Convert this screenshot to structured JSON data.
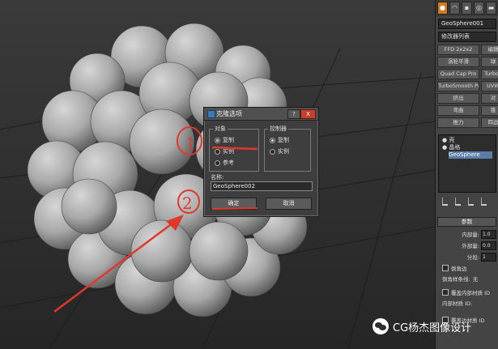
{
  "panel": {
    "tabs": [
      "●",
      "◠",
      "▪",
      "◎",
      "▬",
      "✎"
    ],
    "object_name": "GeoSphere001",
    "modifier_list": "修改器列表",
    "modifier_buttons": [
      "FFD 2x2x2",
      "编辑",
      "涡轮平滑",
      "球",
      "Quad Cap Pro",
      "TurboP",
      "TurboSmooth Pro",
      "UVW",
      "挤出",
      "对",
      "弯曲",
      "锥",
      "推力",
      "四边"
    ],
    "stack": [
      "壳",
      "晶格",
      "GeoSphere"
    ],
    "params_title": "参数",
    "params": [
      {
        "label": "内部量:",
        "value": "1.0"
      },
      {
        "label": "外部量:",
        "value": "0.0"
      },
      {
        "label": "分段:",
        "value": "1"
      }
    ],
    "checkbox_bevel": "倒角边",
    "bevel_spline": "倒角样条线:",
    "bevel_none": "无",
    "override_inner": "覆盖内部材质 ID",
    "inner_mat_id": "内部材质 ID:",
    "override_edge": "覆盖边材质 ID"
  },
  "dialog": {
    "title": "克隆选项",
    "help": "?",
    "close": "X",
    "object_group": "对象",
    "object_options": [
      "复制",
      "实例",
      "参考"
    ],
    "controller_group": "控制器",
    "controller_options": [
      "复制",
      "实例"
    ],
    "name_label": "名称:",
    "name_value": "GeoSphere002",
    "ok": "确定",
    "cancel": "取消"
  },
  "annotations": {
    "mark1": "1",
    "mark2": "2"
  },
  "watermark": "CG杨杰图像设计",
  "colors": {
    "annotation_red": "#e0392b",
    "accent_orange": "#d47a1e",
    "close_red": "#c4412f"
  }
}
